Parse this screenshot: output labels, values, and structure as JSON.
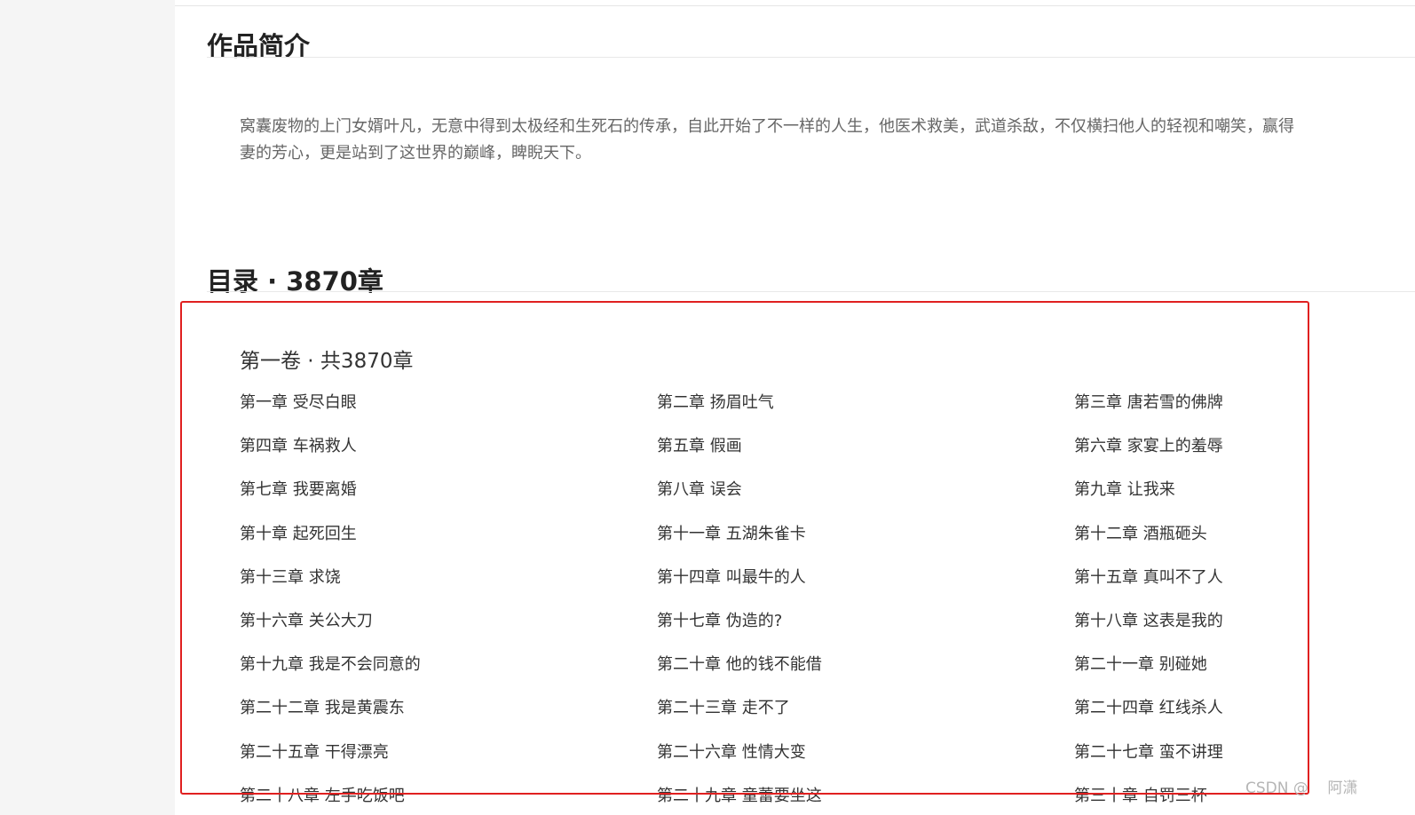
{
  "intro": {
    "title": "作品简介",
    "lines": [
      "窝囊废物的上门女婿叶凡，无意中得到太极经和生死石的传承，自此开始了不一样的人生，他医术救美，武道杀敌，不仅横扫他人的轻视和嘲笑，赢得",
      "妻的芳心，更是站到了这世界的巅峰，睥睨天下。"
    ]
  },
  "toc": {
    "title": "目录 · 3870章",
    "volume_title": "第一卷 · 共3870章",
    "chapters": [
      "第一章 受尽白眼",
      "第二章 扬眉吐气",
      "第三章 唐若雪的佛牌",
      "第四章 车祸救人",
      "第五章 假画",
      "第六章 家宴上的羞辱",
      "第七章 我要离婚",
      "第八章 误会",
      "第九章 让我来",
      "第十章 起死回生",
      "第十一章 五湖朱雀卡",
      "第十二章 酒瓶砸头",
      "第十三章 求饶",
      "第十四章 叫最牛的人",
      "第十五章 真叫不了人",
      "第十六章 关公大刀",
      "第十七章 伪造的?",
      "第十八章 这表是我的",
      "第十九章 我是不会同意的",
      "第二十章 他的钱不能借",
      "第二十一章 别碰她",
      "第二十二章 我是黄震东",
      "第二十三章 走不了",
      "第二十四章 红线杀人",
      "第二十五章 干得漂亮",
      "第二十六章 性情大变",
      "第二十七章 蛮不讲理",
      "第二十八章 左手吃饭吧",
      "第二十九章 童蕾要坐这",
      "第三十章 自罚三杯"
    ]
  },
  "watermark": "CSDN @    阿潇",
  "colors": {
    "highlight_box": "#e02020"
  }
}
